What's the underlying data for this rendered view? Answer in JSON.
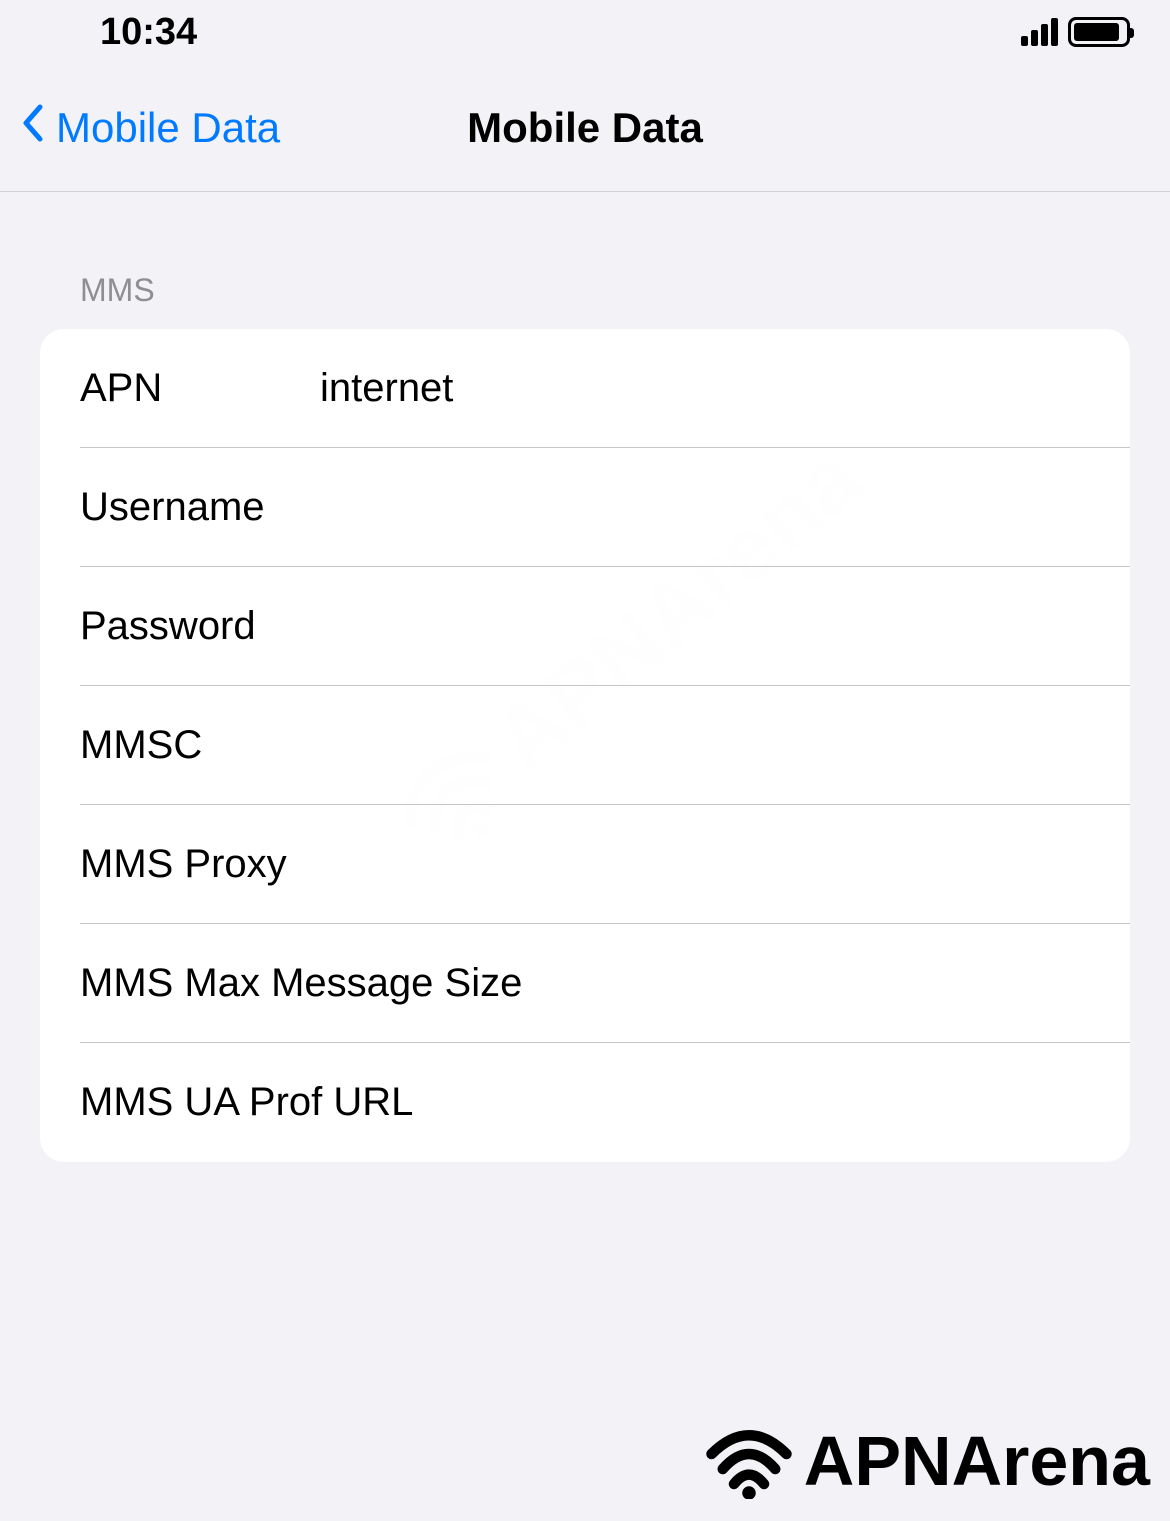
{
  "status_bar": {
    "time": "10:34"
  },
  "nav": {
    "back_label": "Mobile Data",
    "title": "Mobile Data"
  },
  "section": {
    "header": "MMS"
  },
  "fields": {
    "apn": {
      "label": "APN",
      "value": "internet"
    },
    "username": {
      "label": "Username",
      "value": ""
    },
    "password": {
      "label": "Password",
      "value": ""
    },
    "mmsc": {
      "label": "MMSC",
      "value": ""
    },
    "mms_proxy": {
      "label": "MMS Proxy",
      "value": ""
    },
    "mms_max_size": {
      "label": "MMS Max Message Size",
      "value": ""
    },
    "mms_ua_prof": {
      "label": "MMS UA Prof URL",
      "value": ""
    }
  },
  "watermark": {
    "text": "APNArena"
  }
}
